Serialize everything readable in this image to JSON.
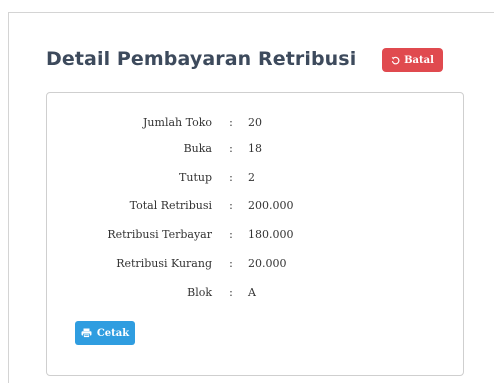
{
  "header": {
    "title": "Detail Pembayaran Retribusi",
    "cancel_label": "Batal",
    "cancel_icon": "undo-icon",
    "cancel_color": "#e04a4f"
  },
  "details": [
    {
      "label": "Jumlah Toko",
      "separator": ":",
      "value": "20"
    },
    {
      "label": "Buka",
      "separator": ":",
      "value": "18"
    },
    {
      "label": "Tutup",
      "separator": ":",
      "value": "2"
    },
    {
      "label": "Total Retribusi",
      "separator": ":",
      "value": "200.000"
    },
    {
      "label": "Retribusi Terbayar",
      "separator": ":",
      "value": "180.000"
    },
    {
      "label": "Retribusi Kurang",
      "separator": ":",
      "value": "20.000"
    },
    {
      "label": "Blok",
      "separator": ":",
      "value": "A"
    }
  ],
  "actions": {
    "print_label": "Cetak",
    "print_icon": "printer-icon",
    "print_color": "#2f9de0"
  }
}
